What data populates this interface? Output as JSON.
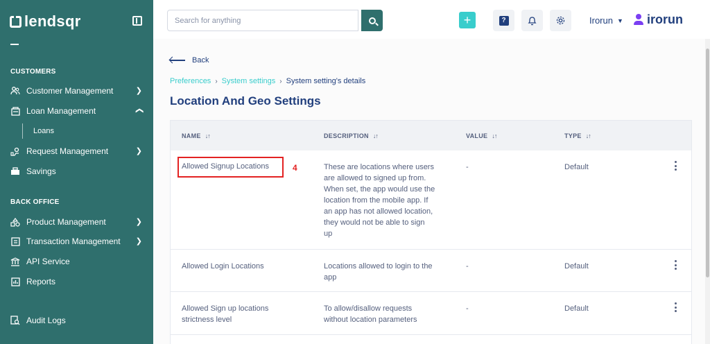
{
  "sidebar": {
    "logo_text": "lendsqr",
    "sections": {
      "customers": "CUSTOMERS",
      "back_office": "BACK OFFICE"
    },
    "items": {
      "customer_management": "Customer Management",
      "loan_management": "Loan Management",
      "loans": "Loans",
      "request_management": "Request Management",
      "savings": "Savings",
      "product_management": "Product Management",
      "transaction_management": "Transaction Management",
      "api_service": "API Service",
      "reports": "Reports",
      "audit_logs": "Audit Logs"
    }
  },
  "header": {
    "search_placeholder": "Search for anything",
    "user_name": "Irorun",
    "brand_name": "irorun"
  },
  "main": {
    "back_label": "Back",
    "breadcrumbs": {
      "preferences": "Preferences",
      "system_settings": "System settings",
      "current": "System setting's details"
    },
    "title": "Location And Geo Settings",
    "table": {
      "columns": {
        "name": "NAME",
        "description": "DESCRIPTION",
        "value": "VALUE",
        "type": "TYPE"
      },
      "rows": [
        {
          "name": "Allowed Signup Locations",
          "description_lines": [
            "These are locations where users",
            "are allowed to signed up from.",
            "When set, the app would use the",
            "location from the mobile app. If",
            "an app has not allowed location,",
            "they would not be able to sign",
            "up"
          ],
          "value": "-",
          "type": "Default"
        },
        {
          "name": "Allowed Login Locations",
          "description_lines": [
            "Locations allowed to login to the",
            "app"
          ],
          "value": "-",
          "type": "Default"
        },
        {
          "name_lines": [
            "Allowed Sign up locations",
            "strictness level"
          ],
          "description_lines": [
            "To allow/disallow requests",
            "without location parameters"
          ],
          "value": "-",
          "type": "Default"
        }
      ]
    },
    "annotation_number": "4"
  },
  "colors": {
    "sidebar_bg": "#2f6f6d",
    "accent": "#39cdcc",
    "primary_text": "#213f7d",
    "highlight": "#e32222",
    "brand_icon": "#7b3ff2"
  }
}
